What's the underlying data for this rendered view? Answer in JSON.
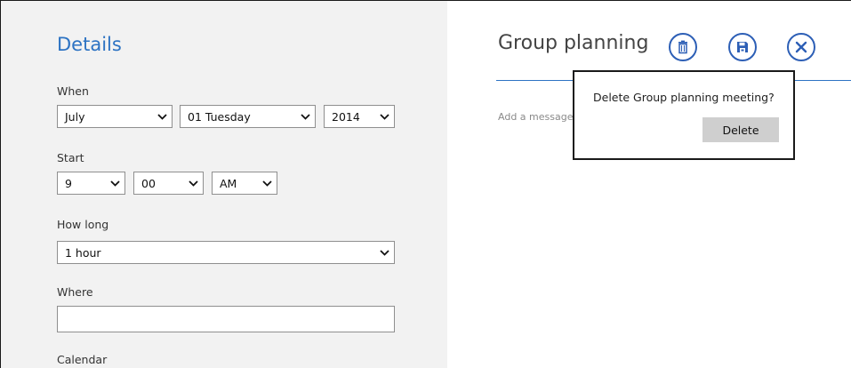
{
  "details": {
    "title": "Details",
    "when_label": "When",
    "month": "July",
    "day": "01 Tuesday",
    "year": "2014",
    "start_label": "Start",
    "hour": "9",
    "minute": "00",
    "ampm": "AM",
    "howlong_label": "How long",
    "duration": "1 hour",
    "where_label": "Where",
    "where_value": "",
    "calendar_label": "Calendar"
  },
  "event": {
    "title": "Group planning",
    "message_placeholder": "Add a message"
  },
  "flyout": {
    "text": "Delete Group planning meeting?",
    "button": "Delete"
  },
  "colors": {
    "accent": "#2d73c3",
    "button_ring": "#2d5fb6",
    "pane_bg": "#f2f2f2"
  },
  "icons": {
    "delete": "trash-icon",
    "save": "save-icon",
    "close": "close-icon",
    "dropdown": "chevron-down-icon"
  }
}
